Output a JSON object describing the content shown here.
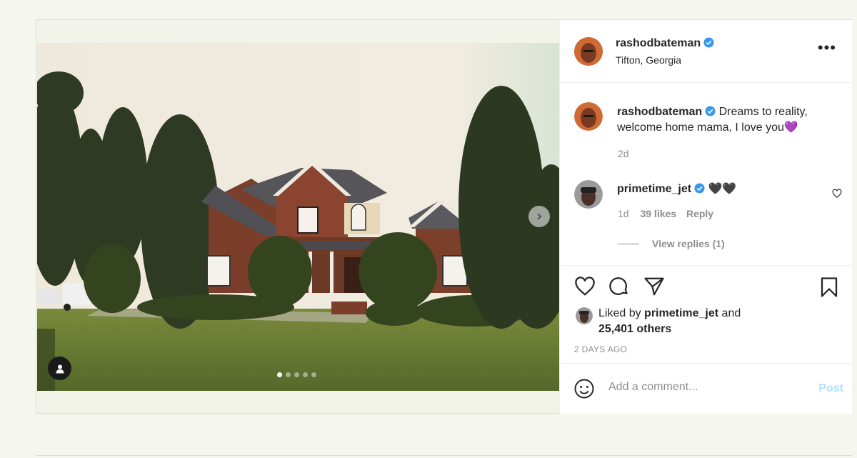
{
  "post": {
    "author": {
      "username": "rashodbateman",
      "location": "Tifton, Georgia"
    },
    "media": {
      "slide_count": 5,
      "active_slide": 1
    },
    "caption": {
      "username": "rashodbateman",
      "text": "Dreams to reality, welcome home mama, I love you",
      "emoji": "💜",
      "time": "2d"
    },
    "comment": {
      "username": "primetime_jet",
      "text": "🖤🖤",
      "time": "1d",
      "likes": "39 likes",
      "reply_label": "Reply",
      "view_replies": "View replies (1)"
    },
    "likes": {
      "prefix": "Liked by",
      "user": "primetime_jet",
      "joiner": "and",
      "others": "25,401 others"
    },
    "timestamp": "2 DAYS AGO",
    "add_comment": {
      "placeholder": "Add a comment...",
      "post_label": "Post"
    },
    "more_label": "•••"
  },
  "colors": {
    "verified": "#3897f0",
    "post_button": "#b2dffc",
    "secondary_text": "#8e8e8e"
  },
  "icons": [
    "heart-icon",
    "comment-icon",
    "share-icon",
    "bookmark-icon",
    "more-icon",
    "verified-icon",
    "user-tag-icon",
    "chevron-right-icon",
    "emoji-icon"
  ]
}
